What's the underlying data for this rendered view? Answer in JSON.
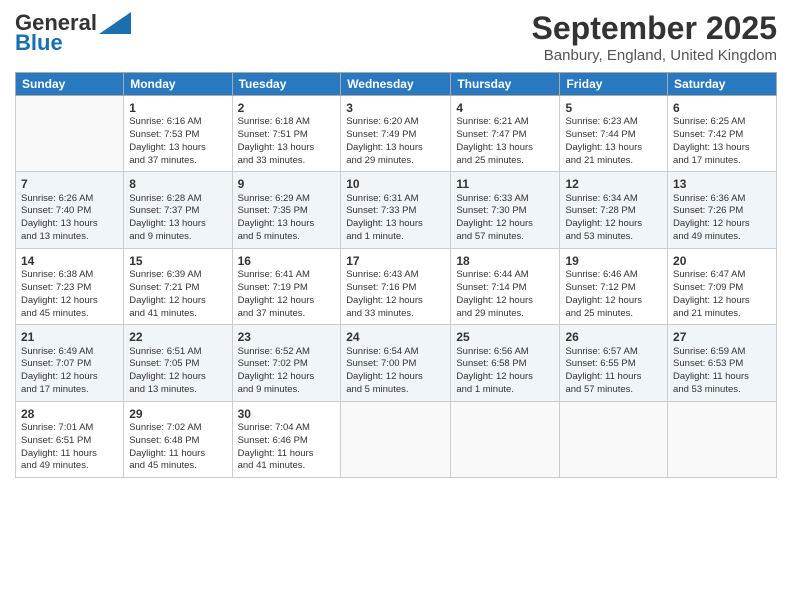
{
  "header": {
    "logo_general": "General",
    "logo_blue": "Blue",
    "month": "September 2025",
    "location": "Banbury, England, United Kingdom"
  },
  "days_of_week": [
    "Sunday",
    "Monday",
    "Tuesday",
    "Wednesday",
    "Thursday",
    "Friday",
    "Saturday"
  ],
  "weeks": [
    [
      {
        "num": "",
        "info": ""
      },
      {
        "num": "1",
        "info": "Sunrise: 6:16 AM\nSunset: 7:53 PM\nDaylight: 13 hours\nand 37 minutes."
      },
      {
        "num": "2",
        "info": "Sunrise: 6:18 AM\nSunset: 7:51 PM\nDaylight: 13 hours\nand 33 minutes."
      },
      {
        "num": "3",
        "info": "Sunrise: 6:20 AM\nSunset: 7:49 PM\nDaylight: 13 hours\nand 29 minutes."
      },
      {
        "num": "4",
        "info": "Sunrise: 6:21 AM\nSunset: 7:47 PM\nDaylight: 13 hours\nand 25 minutes."
      },
      {
        "num": "5",
        "info": "Sunrise: 6:23 AM\nSunset: 7:44 PM\nDaylight: 13 hours\nand 21 minutes."
      },
      {
        "num": "6",
        "info": "Sunrise: 6:25 AM\nSunset: 7:42 PM\nDaylight: 13 hours\nand 17 minutes."
      }
    ],
    [
      {
        "num": "7",
        "info": "Sunrise: 6:26 AM\nSunset: 7:40 PM\nDaylight: 13 hours\nand 13 minutes."
      },
      {
        "num": "8",
        "info": "Sunrise: 6:28 AM\nSunset: 7:37 PM\nDaylight: 13 hours\nand 9 minutes."
      },
      {
        "num": "9",
        "info": "Sunrise: 6:29 AM\nSunset: 7:35 PM\nDaylight: 13 hours\nand 5 minutes."
      },
      {
        "num": "10",
        "info": "Sunrise: 6:31 AM\nSunset: 7:33 PM\nDaylight: 13 hours\nand 1 minute."
      },
      {
        "num": "11",
        "info": "Sunrise: 6:33 AM\nSunset: 7:30 PM\nDaylight: 12 hours\nand 57 minutes."
      },
      {
        "num": "12",
        "info": "Sunrise: 6:34 AM\nSunset: 7:28 PM\nDaylight: 12 hours\nand 53 minutes."
      },
      {
        "num": "13",
        "info": "Sunrise: 6:36 AM\nSunset: 7:26 PM\nDaylight: 12 hours\nand 49 minutes."
      }
    ],
    [
      {
        "num": "14",
        "info": "Sunrise: 6:38 AM\nSunset: 7:23 PM\nDaylight: 12 hours\nand 45 minutes."
      },
      {
        "num": "15",
        "info": "Sunrise: 6:39 AM\nSunset: 7:21 PM\nDaylight: 12 hours\nand 41 minutes."
      },
      {
        "num": "16",
        "info": "Sunrise: 6:41 AM\nSunset: 7:19 PM\nDaylight: 12 hours\nand 37 minutes."
      },
      {
        "num": "17",
        "info": "Sunrise: 6:43 AM\nSunset: 7:16 PM\nDaylight: 12 hours\nand 33 minutes."
      },
      {
        "num": "18",
        "info": "Sunrise: 6:44 AM\nSunset: 7:14 PM\nDaylight: 12 hours\nand 29 minutes."
      },
      {
        "num": "19",
        "info": "Sunrise: 6:46 AM\nSunset: 7:12 PM\nDaylight: 12 hours\nand 25 minutes."
      },
      {
        "num": "20",
        "info": "Sunrise: 6:47 AM\nSunset: 7:09 PM\nDaylight: 12 hours\nand 21 minutes."
      }
    ],
    [
      {
        "num": "21",
        "info": "Sunrise: 6:49 AM\nSunset: 7:07 PM\nDaylight: 12 hours\nand 17 minutes."
      },
      {
        "num": "22",
        "info": "Sunrise: 6:51 AM\nSunset: 7:05 PM\nDaylight: 12 hours\nand 13 minutes."
      },
      {
        "num": "23",
        "info": "Sunrise: 6:52 AM\nSunset: 7:02 PM\nDaylight: 12 hours\nand 9 minutes."
      },
      {
        "num": "24",
        "info": "Sunrise: 6:54 AM\nSunset: 7:00 PM\nDaylight: 12 hours\nand 5 minutes."
      },
      {
        "num": "25",
        "info": "Sunrise: 6:56 AM\nSunset: 6:58 PM\nDaylight: 12 hours\nand 1 minute."
      },
      {
        "num": "26",
        "info": "Sunrise: 6:57 AM\nSunset: 6:55 PM\nDaylight: 11 hours\nand 57 minutes."
      },
      {
        "num": "27",
        "info": "Sunrise: 6:59 AM\nSunset: 6:53 PM\nDaylight: 11 hours\nand 53 minutes."
      }
    ],
    [
      {
        "num": "28",
        "info": "Sunrise: 7:01 AM\nSunset: 6:51 PM\nDaylight: 11 hours\nand 49 minutes."
      },
      {
        "num": "29",
        "info": "Sunrise: 7:02 AM\nSunset: 6:48 PM\nDaylight: 11 hours\nand 45 minutes."
      },
      {
        "num": "30",
        "info": "Sunrise: 7:04 AM\nSunset: 6:46 PM\nDaylight: 11 hours\nand 41 minutes."
      },
      {
        "num": "",
        "info": ""
      },
      {
        "num": "",
        "info": ""
      },
      {
        "num": "",
        "info": ""
      },
      {
        "num": "",
        "info": ""
      }
    ]
  ]
}
